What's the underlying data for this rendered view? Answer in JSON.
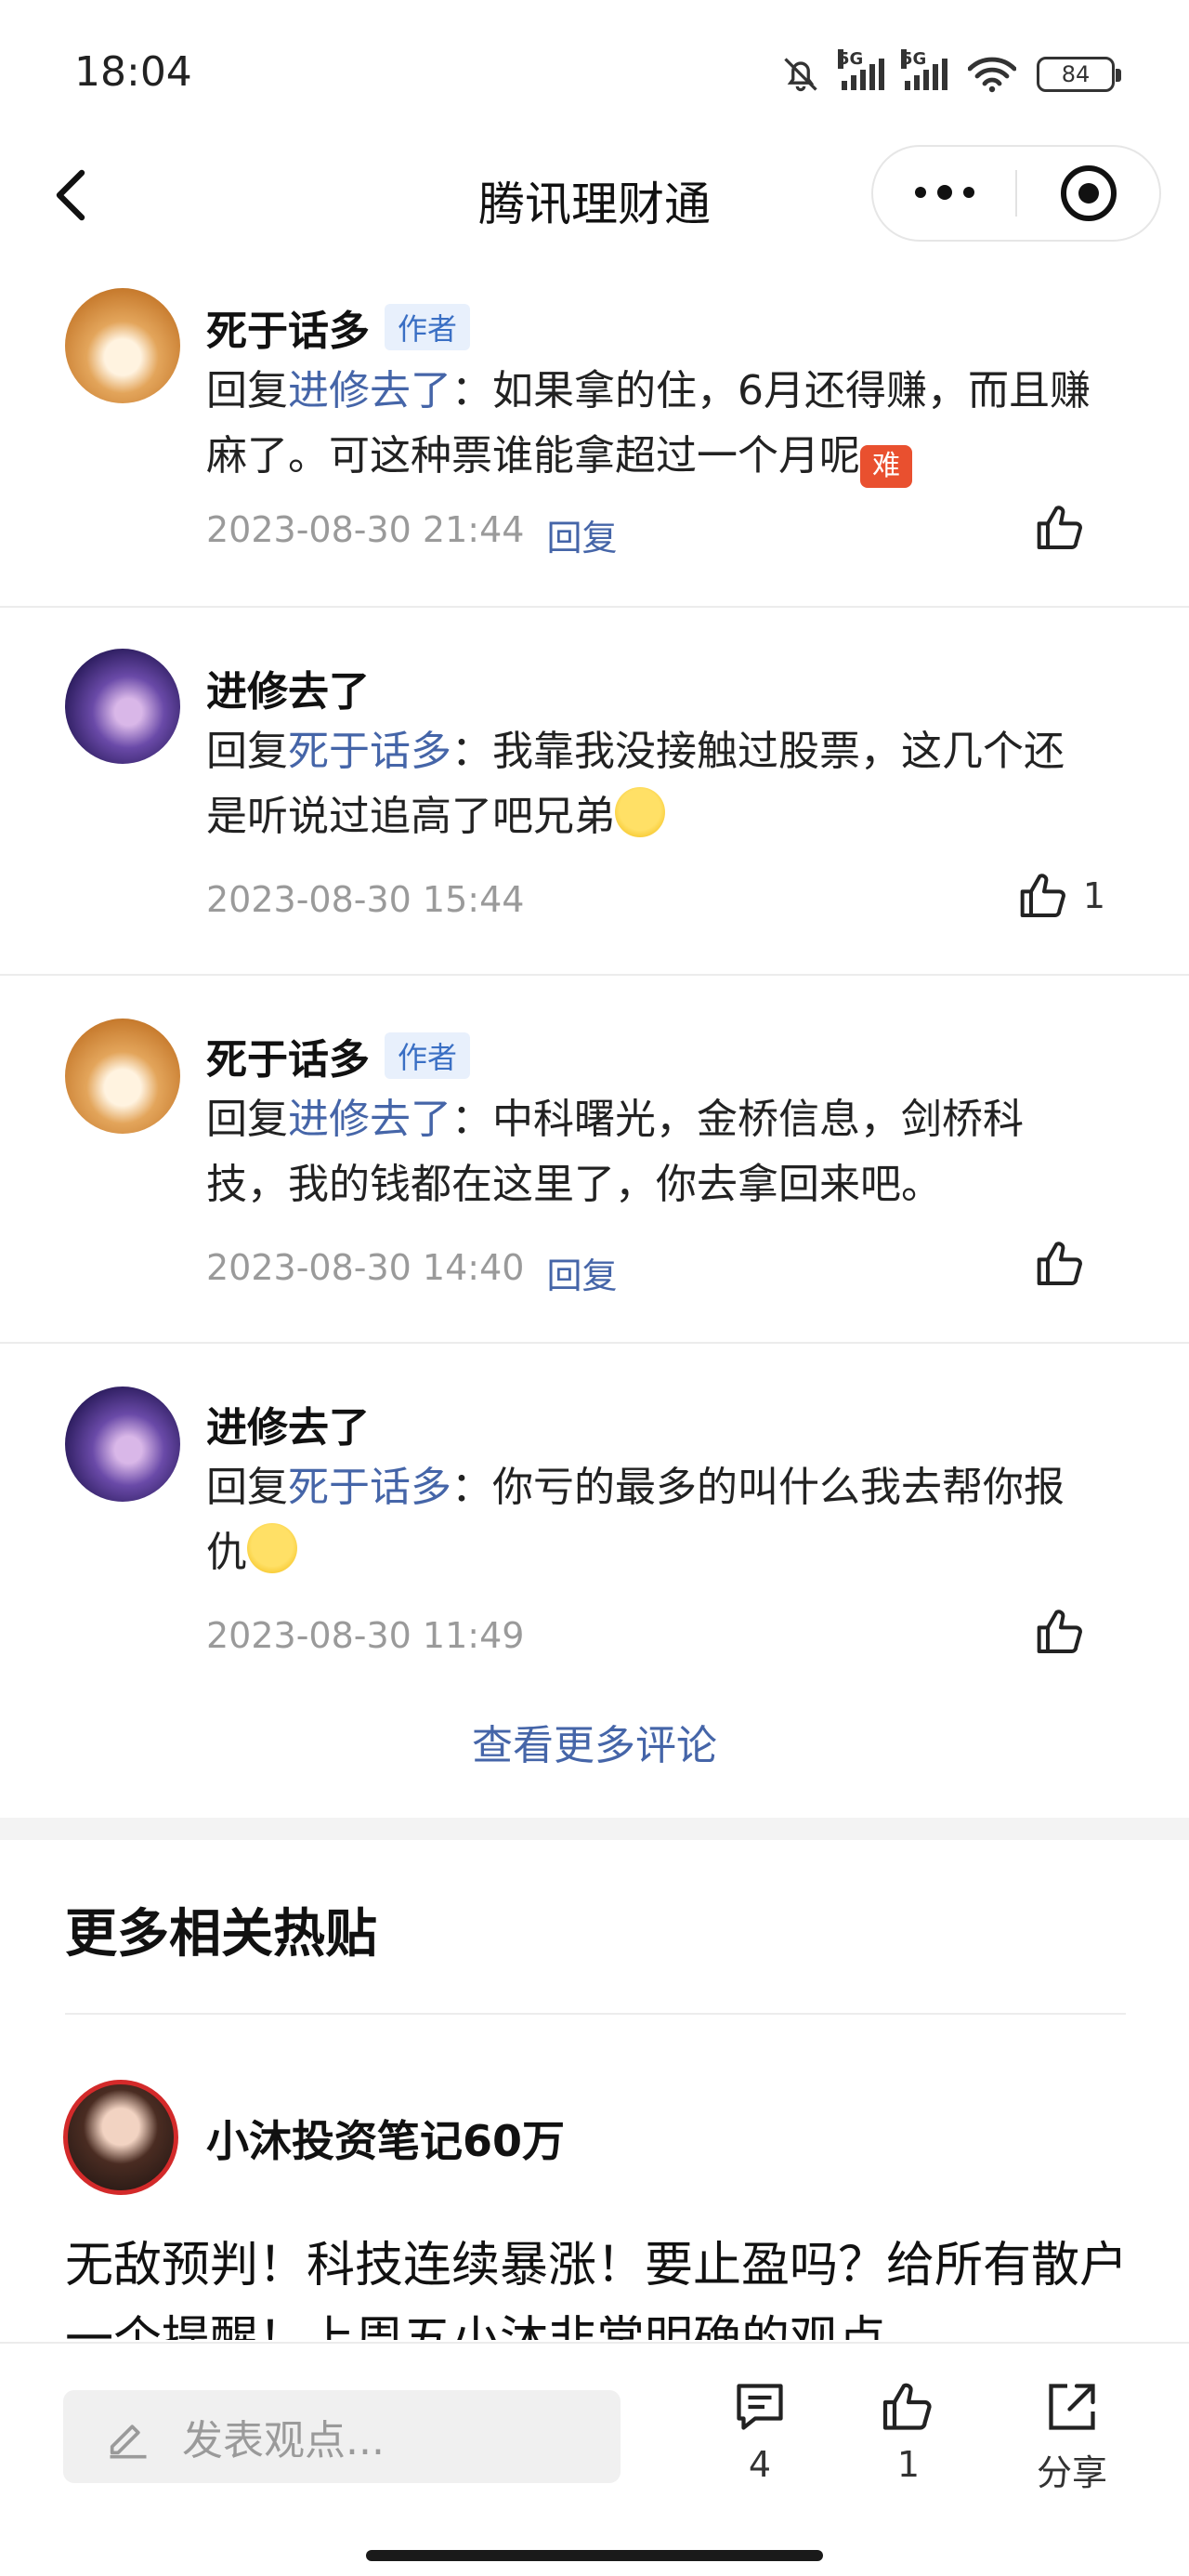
{
  "status": {
    "time": "18:04",
    "battery": "84",
    "net1": "5G",
    "net2": "5G"
  },
  "nav": {
    "title": "腾讯理财通"
  },
  "comments": [
    {
      "name": "死于话多",
      "tag": "作者",
      "reply_prefix": "回复",
      "mention": "进修去了",
      "sep": "：",
      "text": "如果拿的住，6月还得赚，而且赚麻了。可这种票谁能拿超过一个月呢",
      "emoji": "难",
      "time": "2023-08-30 21:44",
      "reply_label": "回复",
      "likes": ""
    },
    {
      "name": "进修去了",
      "tag": "",
      "reply_prefix": "回复",
      "mention": "死于话多",
      "sep": "：",
      "text": "我靠我没接触过股票，这几个还是听说过追高了吧兄弟",
      "emoji": "dizzy",
      "time": "2023-08-30 15:44",
      "reply_label": "",
      "likes": "1"
    },
    {
      "name": "死于话多",
      "tag": "作者",
      "reply_prefix": "回复",
      "mention": "进修去了",
      "sep": "：",
      "text": "中科曙光，金桥信息，剑桥科技，我的钱都在这里了，你去拿回来吧。",
      "emoji": "",
      "time": "2023-08-30 14:40",
      "reply_label": "回复",
      "likes": ""
    },
    {
      "name": "进修去了",
      "tag": "",
      "reply_prefix": "回复",
      "mention": "死于话多",
      "sep": "：",
      "text": "你亏的最多的叫什么我去帮你报仇",
      "emoji": "grin",
      "time": "2023-08-30 11:49",
      "reply_label": "",
      "likes": ""
    }
  ],
  "more_comments": "查看更多评论",
  "related": {
    "title": "更多相关热贴",
    "post": {
      "author": "小沐投资笔记60万",
      "text": "无敌预判！科技连续暴涨！要止盈吗？给所有散户一个提醒！上周五小沐非常明确的观点"
    }
  },
  "bottom": {
    "placeholder": "发表观点...",
    "comment_count": "4",
    "like_count": "1",
    "share_label": "分享"
  }
}
